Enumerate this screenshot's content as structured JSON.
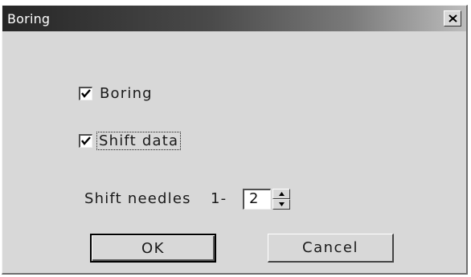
{
  "window": {
    "title": "Boring",
    "close_icon": "close-icon"
  },
  "options": {
    "boring": {
      "label": "Boring",
      "checked": true
    },
    "shift_data": {
      "label": "Shift data",
      "checked": true
    }
  },
  "shift_needles": {
    "label": "Shift needles",
    "range_prefix": "1-",
    "value": "2"
  },
  "buttons": {
    "ok": "OK",
    "cancel": "Cancel"
  }
}
